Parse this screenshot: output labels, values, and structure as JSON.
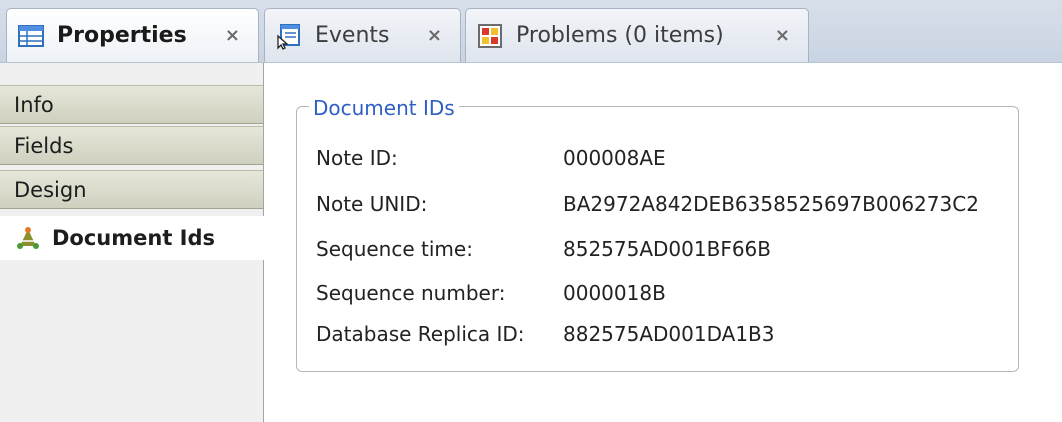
{
  "tabs": [
    {
      "label": "Properties",
      "icon": "properties-table-icon",
      "active": true,
      "close": "×"
    },
    {
      "label": "Events",
      "icon": "events-pointer-icon",
      "active": false,
      "close": "×"
    },
    {
      "label": "Problems (0 items)",
      "icon": "problems-icon",
      "active": false,
      "close": "×"
    }
  ],
  "leftnav": {
    "items": [
      {
        "label": "Info"
      },
      {
        "label": "Fields"
      },
      {
        "label": "Design"
      },
      {
        "label": "Document Ids",
        "icon": "document-ids-icon",
        "selected": true
      }
    ]
  },
  "group": {
    "title": "Document IDs",
    "rows": [
      {
        "label": "Note ID:",
        "value": "000008AE"
      },
      {
        "label": "Note UNID:",
        "value": "BA2972A842DEB6358525697B006273C2"
      },
      {
        "label": "Sequence time:",
        "value": "852575AD001BF66B"
      },
      {
        "label": "Sequence number:",
        "value": "0000018B"
      },
      {
        "label": "Database Replica ID:",
        "value": "882575AD001DA1B3"
      }
    ]
  },
  "colors": {
    "legend": "#2e5fc4",
    "tabbar": "#c9d4e3",
    "nav_item": "#d8d9c6"
  }
}
